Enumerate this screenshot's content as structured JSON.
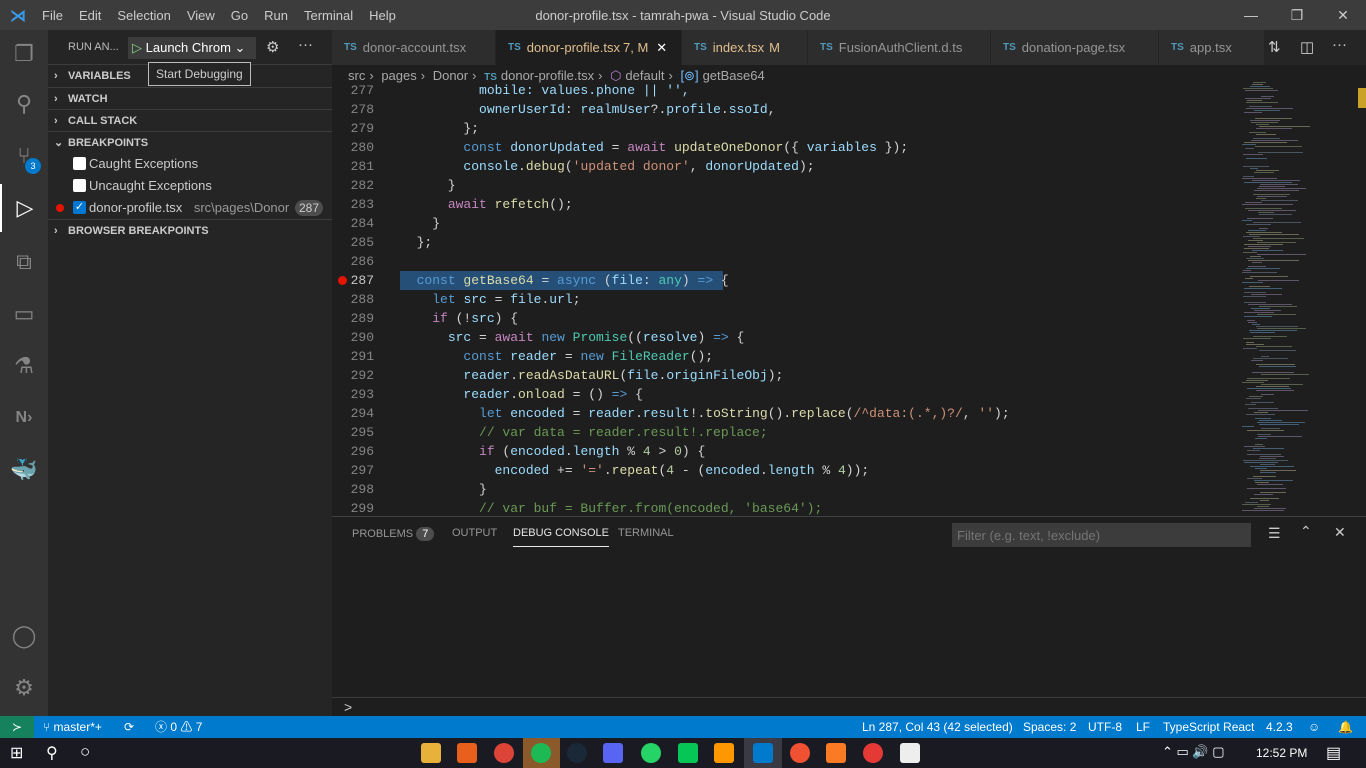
{
  "window": {
    "title": "donor-profile.tsx - tamrah-pwa - Visual Studio Code",
    "menu": [
      "File",
      "Edit",
      "Selection",
      "View",
      "Go",
      "Run",
      "Terminal",
      "Help"
    ]
  },
  "activity_bar": {
    "scm_badge": "3"
  },
  "sidebar": {
    "header": "RUN AN...",
    "launch_config": "Launch Chrom",
    "tooltip": "Start Debugging",
    "sections": [
      "VARIABLES",
      "WATCH",
      "CALL STACK",
      "BREAKPOINTS",
      "BROWSER BREAKPOINTS"
    ],
    "breakpoints": [
      {
        "label": "Caught Exceptions",
        "checked": false
      },
      {
        "label": "Uncaught Exceptions",
        "checked": false
      },
      {
        "label": "donor-profile.tsx",
        "path": "src\\pages\\Donor",
        "line": "287",
        "checked": true
      }
    ]
  },
  "tabs": [
    {
      "label": "donor-account.tsx"
    },
    {
      "label": "donor-profile.tsx",
      "status": "7, M",
      "active": true
    },
    {
      "label": "index.tsx",
      "status": "M"
    },
    {
      "label": "FusionAuthClient.d.ts"
    },
    {
      "label": "donation-page.tsx"
    },
    {
      "label": "app.tsx"
    }
  ],
  "tab_icon": "TS",
  "breadcrumbs": [
    "src",
    "pages",
    "Donor",
    "donor-profile.tsx",
    "default",
    "getBase64"
  ],
  "code": {
    "first_line": 277,
    "current_line": 287,
    "lines": [
      [
        [
          "          mobile: values.phone || '',",
          "v"
        ]
      ],
      [
        [
          "          ",
          "p"
        ],
        [
          "ownerUserId",
          "v"
        ],
        [
          ": ",
          "p"
        ],
        [
          "realmUser",
          "v"
        ],
        [
          "?.",
          "p"
        ],
        [
          "profile",
          "v"
        ],
        [
          ".",
          "p"
        ],
        [
          "ssoId",
          "v"
        ],
        [
          ",",
          "p"
        ]
      ],
      [
        [
          "        };",
          "p"
        ]
      ],
      [
        [
          "        ",
          "p"
        ],
        [
          "const ",
          "k"
        ],
        [
          "donorUpdated",
          "v"
        ],
        [
          " = ",
          "p"
        ],
        [
          "await ",
          "c"
        ],
        [
          "updateOneDonor",
          "f"
        ],
        [
          "({ ",
          "p"
        ],
        [
          "variables",
          "v"
        ],
        [
          " });",
          "p"
        ]
      ],
      [
        [
          "        ",
          "p"
        ],
        [
          "console",
          "v"
        ],
        [
          ".",
          "p"
        ],
        [
          "debug",
          "f"
        ],
        [
          "(",
          "p"
        ],
        [
          "'updated donor'",
          "s"
        ],
        [
          ", ",
          "p"
        ],
        [
          "donorUpdated",
          "v"
        ],
        [
          ");",
          "p"
        ]
      ],
      [
        [
          "      }",
          "p"
        ]
      ],
      [
        [
          "      ",
          "p"
        ],
        [
          "await ",
          "c"
        ],
        [
          "refetch",
          "f"
        ],
        [
          "();",
          "p"
        ]
      ],
      [
        [
          "    }",
          "p"
        ]
      ],
      [
        [
          "  };",
          "p"
        ]
      ],
      [
        [
          "",
          "p"
        ]
      ],
      [
        [
          "  ",
          "p"
        ],
        [
          "const ",
          "k"
        ],
        [
          "getBase64",
          "f"
        ],
        [
          " = ",
          "p"
        ],
        [
          "async ",
          "k"
        ],
        [
          "(",
          "p"
        ],
        [
          "file",
          "v"
        ],
        [
          ": ",
          "p"
        ],
        [
          "any",
          "t"
        ],
        [
          ") ",
          "p"
        ],
        [
          "=> ",
          "k"
        ],
        [
          "{",
          "p"
        ]
      ],
      [
        [
          "    ",
          "p"
        ],
        [
          "let ",
          "k"
        ],
        [
          "src",
          "v"
        ],
        [
          " = ",
          "p"
        ],
        [
          "file",
          "v"
        ],
        [
          ".",
          "p"
        ],
        [
          "url",
          "v"
        ],
        [
          ";",
          "p"
        ]
      ],
      [
        [
          "    ",
          "p"
        ],
        [
          "if ",
          "c"
        ],
        [
          "(!",
          "p"
        ],
        [
          "src",
          "v"
        ],
        [
          ") {",
          "p"
        ]
      ],
      [
        [
          "      ",
          "p"
        ],
        [
          "src",
          "v"
        ],
        [
          " = ",
          "p"
        ],
        [
          "await ",
          "c"
        ],
        [
          "new ",
          "k"
        ],
        [
          "Promise",
          "t"
        ],
        [
          "((",
          "p"
        ],
        [
          "resolve",
          "v"
        ],
        [
          ") ",
          "p"
        ],
        [
          "=> ",
          "k"
        ],
        [
          "{",
          "p"
        ]
      ],
      [
        [
          "        ",
          "p"
        ],
        [
          "const ",
          "k"
        ],
        [
          "reader",
          "v"
        ],
        [
          " = ",
          "p"
        ],
        [
          "new ",
          "k"
        ],
        [
          "FileReader",
          "t"
        ],
        [
          "();",
          "p"
        ]
      ],
      [
        [
          "        ",
          "p"
        ],
        [
          "reader",
          "v"
        ],
        [
          ".",
          "p"
        ],
        [
          "readAsDataURL",
          "f"
        ],
        [
          "(",
          "p"
        ],
        [
          "file",
          "v"
        ],
        [
          ".",
          "p"
        ],
        [
          "originFileObj",
          "v"
        ],
        [
          ");",
          "p"
        ]
      ],
      [
        [
          "        ",
          "p"
        ],
        [
          "reader",
          "v"
        ],
        [
          ".",
          "p"
        ],
        [
          "onload",
          "f"
        ],
        [
          " = () ",
          "p"
        ],
        [
          "=> ",
          "k"
        ],
        [
          "{",
          "p"
        ]
      ],
      [
        [
          "          ",
          "p"
        ],
        [
          "let ",
          "k"
        ],
        [
          "encoded",
          "v"
        ],
        [
          " = ",
          "p"
        ],
        [
          "reader",
          "v"
        ],
        [
          ".",
          "p"
        ],
        [
          "result",
          "v"
        ],
        [
          "!.",
          "p"
        ],
        [
          "toString",
          "f"
        ],
        [
          "().",
          "p"
        ],
        [
          "replace",
          "f"
        ],
        [
          "(",
          "p"
        ],
        [
          "/^",
          "s"
        ],
        [
          "data:",
          "s"
        ],
        [
          "(.*,)?",
          "s"
        ],
        [
          "/",
          "s"
        ],
        [
          ", ",
          "p"
        ],
        [
          "''",
          "s"
        ],
        [
          ");",
          "p"
        ]
      ],
      [
        [
          "          ",
          "p"
        ],
        [
          "// var data = reader.result!.replace;",
          "cm"
        ]
      ],
      [
        [
          "          ",
          "p"
        ],
        [
          "if ",
          "c"
        ],
        [
          "(",
          "p"
        ],
        [
          "encoded",
          "v"
        ],
        [
          ".",
          "p"
        ],
        [
          "length",
          "v"
        ],
        [
          " % ",
          "p"
        ],
        [
          "4",
          "n"
        ],
        [
          " > ",
          "p"
        ],
        [
          "0",
          "n"
        ],
        [
          ") {",
          "p"
        ]
      ],
      [
        [
          "            ",
          "p"
        ],
        [
          "encoded",
          "v"
        ],
        [
          " += ",
          "p"
        ],
        [
          "'='",
          "s"
        ],
        [
          ".",
          "p"
        ],
        [
          "repeat",
          "f"
        ],
        [
          "(",
          "p"
        ],
        [
          "4",
          "n"
        ],
        [
          " - (",
          "p"
        ],
        [
          "encoded",
          "v"
        ],
        [
          ".",
          "p"
        ],
        [
          "length",
          "v"
        ],
        [
          " % ",
          "p"
        ],
        [
          "4",
          "n"
        ],
        [
          "));",
          "p"
        ]
      ],
      [
        [
          "          }",
          "p"
        ]
      ],
      [
        [
          "          ",
          "p"
        ],
        [
          "// var buf = Buffer.from(encoded, 'base64');",
          "cm"
        ]
      ]
    ]
  },
  "panel": {
    "tabs": [
      "PROBLEMS",
      "OUTPUT",
      "DEBUG CONSOLE",
      "TERMINAL"
    ],
    "problems_count": "7",
    "active_tab": "DEBUG CONSOLE",
    "filter_placeholder": "Filter (e.g. text, !exclude)",
    "prompt": ">"
  },
  "status_bar": {
    "branch": "master*+",
    "errors": "0",
    "warnings": "7",
    "position": "Ln 287, Col 43 (42 selected)",
    "spaces": "Spaces: 2",
    "encoding": "UTF-8",
    "eol": "LF",
    "language": "TypeScript React",
    "ts_version": "4.2.3"
  },
  "taskbar": {
    "time": "12:52 PM"
  },
  "colors": {
    "accent": "#007acc",
    "breakpoint": "#e51400",
    "selection": "#264f78"
  }
}
